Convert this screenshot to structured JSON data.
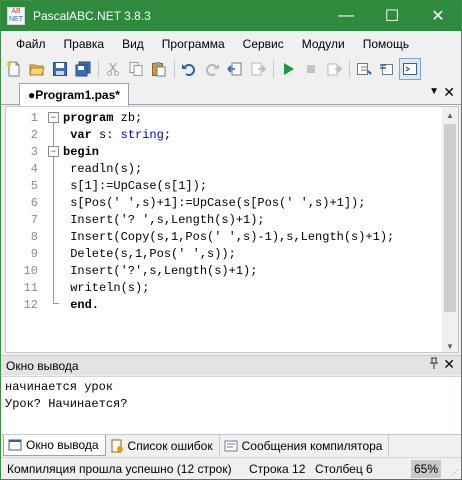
{
  "window": {
    "title": "PascalABC.NET 3.8.3",
    "icon_text_top": "AB",
    "icon_text_bottom": "NET",
    "minimize": "—",
    "maximize": "☐",
    "close": "✕"
  },
  "menu": [
    "Файл",
    "Правка",
    "Вид",
    "Программа",
    "Сервис",
    "Модули",
    "Помощь"
  ],
  "editor_tab": {
    "label": "●Program1.pas*",
    "dropdown": "▼",
    "close": "✕"
  },
  "editor": {
    "line_numbers": [
      "1",
      "2",
      "3",
      "4",
      "5",
      "6",
      "7",
      "8",
      "9",
      "10",
      "11",
      "12"
    ],
    "lines": [
      [
        {
          "t": "program",
          "c": "kw"
        },
        {
          "t": " zb;",
          "c": ""
        }
      ],
      [
        {
          "t": " var",
          "c": "kw"
        },
        {
          "t": " s: ",
          "c": ""
        },
        {
          "t": "string",
          "c": "ty"
        },
        {
          "t": ";",
          "c": ""
        }
      ],
      [
        {
          "t": "begin",
          "c": "kw"
        }
      ],
      [
        {
          "t": " readln(s);",
          "c": ""
        }
      ],
      [
        {
          "t": " s[1]:=UpCase(s[1]);",
          "c": ""
        }
      ],
      [
        {
          "t": " s[Pos(' ',s)+1]:=UpCase(s[Pos(' ',s)+1]);",
          "c": ""
        }
      ],
      [
        {
          "t": " Insert('? ',s,Length(s)+1);",
          "c": ""
        }
      ],
      [
        {
          "t": " Insert(Copy(s,1,Pos(' ',s)-1),s,Length(s)+1);",
          "c": ""
        }
      ],
      [
        {
          "t": " Delete(s,1,Pos(' ',s));",
          "c": ""
        }
      ],
      [
        {
          "t": " Insert('?',s,Length(s)+1);",
          "c": ""
        }
      ],
      [
        {
          "t": " writeln(s);",
          "c": ""
        }
      ],
      [
        {
          "t": " end.",
          "c": "kw"
        }
      ]
    ]
  },
  "output": {
    "title": "Окно вывода",
    "pin": "📌",
    "close": "✕",
    "text": "начинается урок\nУрок? Начинается?"
  },
  "bottom_tabs": [
    {
      "label": "Окно вывода",
      "icon": "output-window-icon"
    },
    {
      "label": "Список ошибок",
      "icon": "error-list-icon"
    },
    {
      "label": "Сообщения компилятора",
      "icon": "compiler-messages-icon"
    }
  ],
  "status": {
    "message": "Компиляция прошла успешно (12 строк)",
    "row_label": "Строка  12",
    "col_label": "Столбец  6",
    "zoom": "65%"
  },
  "colors": {
    "titlebar": "#2e8b3e",
    "keyword": "#000000",
    "type": "#0000c8"
  }
}
